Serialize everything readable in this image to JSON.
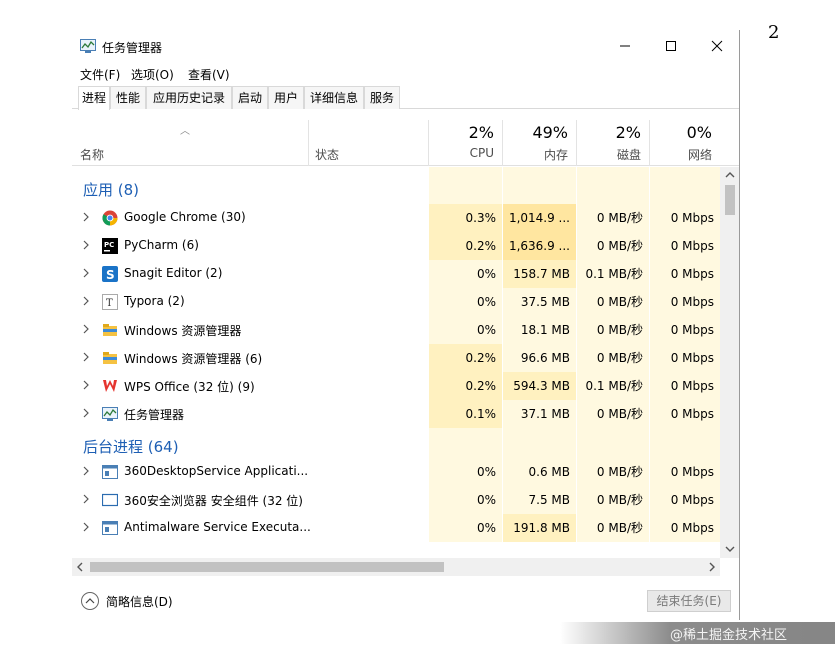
{
  "page_number": "2",
  "window": {
    "title": "任务管理器",
    "controls": {
      "minimize": "—",
      "maximize": "☐",
      "close": "✕"
    }
  },
  "menu": [
    "文件(F)",
    "选项(O)",
    "查看(V)"
  ],
  "tabs": [
    "进程",
    "性能",
    "应用历史记录",
    "启动",
    "用户",
    "详细信息",
    "服务"
  ],
  "active_tab": "进程",
  "columns": {
    "name": "名称",
    "status": "状态",
    "cpu": {
      "pct": "2%",
      "label": "CPU"
    },
    "memory": {
      "pct": "49%",
      "label": "内存"
    },
    "disk": {
      "pct": "2%",
      "label": "磁盘"
    },
    "network": {
      "pct": "0%",
      "label": "网络"
    }
  },
  "groups": [
    {
      "title": "应用 (8)",
      "rows": [
        {
          "icon": "chrome-icon",
          "name": "Google Chrome (30)",
          "cpu": "0.3%",
          "mem": "1,014.9 ...",
          "disk": "0 MB/秒",
          "net": "0 Mbps"
        },
        {
          "icon": "pycharm-icon",
          "name": "PyCharm (6)",
          "cpu": "0.2%",
          "mem": "1,636.9 ...",
          "disk": "0 MB/秒",
          "net": "0 Mbps"
        },
        {
          "icon": "snagit-icon",
          "name": "Snagit Editor (2)",
          "cpu": "0%",
          "mem": "158.7 MB",
          "disk": "0.1 MB/秒",
          "net": "0 Mbps"
        },
        {
          "icon": "typora-icon",
          "name": "Typora (2)",
          "cpu": "0%",
          "mem": "37.5 MB",
          "disk": "0 MB/秒",
          "net": "0 Mbps"
        },
        {
          "icon": "folder-icon",
          "name": "Windows 资源管理器",
          "cpu": "0%",
          "mem": "18.1 MB",
          "disk": "0 MB/秒",
          "net": "0 Mbps"
        },
        {
          "icon": "folder-icon",
          "name": "Windows 资源管理器 (6)",
          "cpu": "0.2%",
          "mem": "96.6 MB",
          "disk": "0 MB/秒",
          "net": "0 Mbps"
        },
        {
          "icon": "wps-icon",
          "name": "WPS Office (32 位) (9)",
          "cpu": "0.2%",
          "mem": "594.3 MB",
          "disk": "0.1 MB/秒",
          "net": "0 Mbps"
        },
        {
          "icon": "task-manager-icon",
          "name": "任务管理器",
          "cpu": "0.1%",
          "mem": "37.1 MB",
          "disk": "0 MB/秒",
          "net": "0 Mbps"
        }
      ]
    },
    {
      "title": "后台进程 (64)",
      "rows": [
        {
          "icon": "service-icon",
          "name": "360DesktopService Applicati...",
          "cpu": "0%",
          "mem": "0.6 MB",
          "disk": "0 MB/秒",
          "net": "0 Mbps"
        },
        {
          "icon": "window-icon",
          "name": "360安全浏览器 安全组件 (32 位)",
          "cpu": "0%",
          "mem": "7.5 MB",
          "disk": "0 MB/秒",
          "net": "0 Mbps"
        },
        {
          "icon": "service-icon",
          "name": "Antimalware Service Executa...",
          "cpu": "0%",
          "mem": "191.8 MB",
          "disk": "0 MB/秒",
          "net": "0 Mbps"
        }
      ]
    }
  ],
  "footer": {
    "brief_label": "简略信息(D)",
    "end_task_label": "结束任务(E)"
  },
  "watermark": "@稀土掘金技术社区",
  "colors": {
    "accent": "#1e5fb4",
    "heat_light": "#fff9e0",
    "heat_medium": "#fff1c0",
    "heat_strong": "#ffe6a0"
  }
}
